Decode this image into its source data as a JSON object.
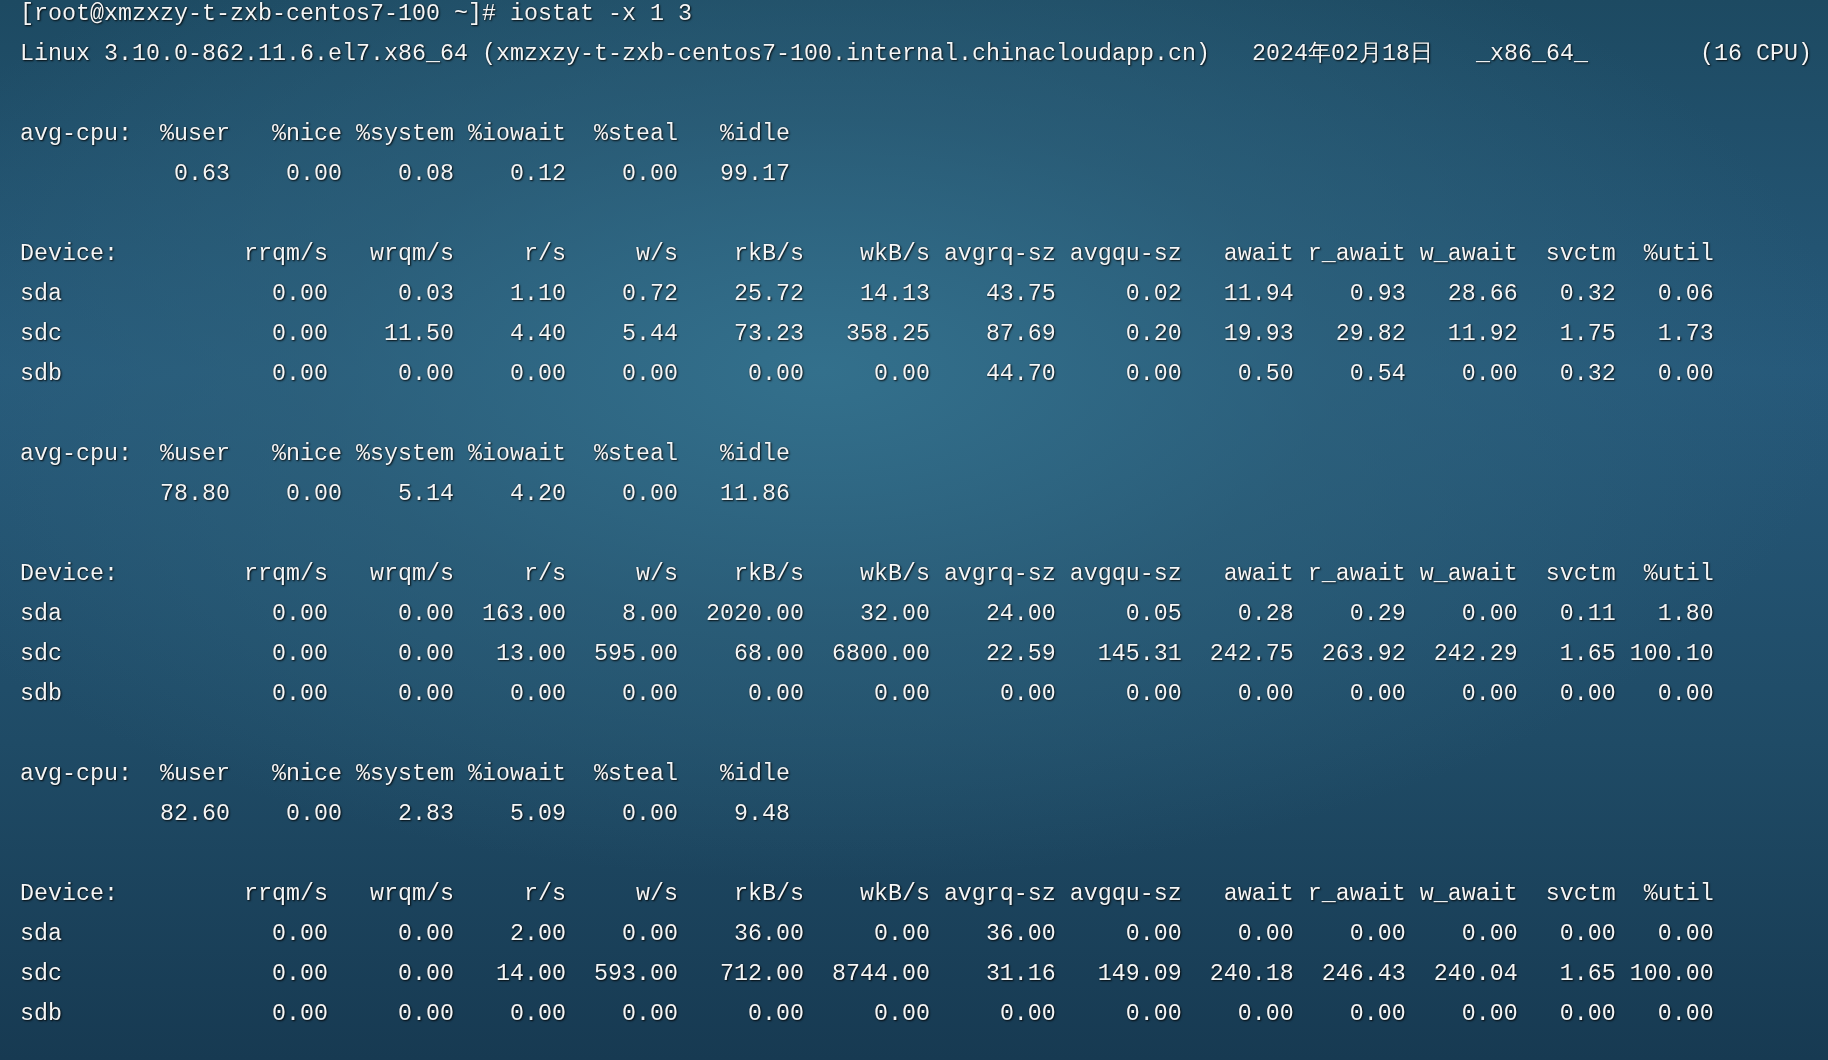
{
  "prompt": {
    "user_host": "[root@xmzxzy-t-zxb-centos7-100 ~]#",
    "command": "iostat -x 1 3"
  },
  "system_info": {
    "kernel": "Linux 3.10.0-862.11.6.el7.x86_64 (xmzxzy-t-zxb-centos7-100.internal.chinacloudapp.cn)",
    "date": "2024年02月18日",
    "arch": "_x86_64_",
    "cpus": "(16 CPU)"
  },
  "reports": [
    {
      "cpu": {
        "label": "avg-cpu:",
        "columns": [
          "%user",
          "%nice",
          "%system",
          "%iowait",
          "%steal",
          "%idle"
        ],
        "values": [
          "0.63",
          "0.00",
          "0.08",
          "0.12",
          "0.00",
          "99.17"
        ]
      },
      "devices": {
        "columns": [
          "Device:",
          "rrqm/s",
          "wrqm/s",
          "r/s",
          "w/s",
          "rkB/s",
          "wkB/s",
          "avgrq-sz",
          "avgqu-sz",
          "await",
          "r_await",
          "w_await",
          "svctm",
          "%util"
        ],
        "rows": [
          {
            "device": "sda",
            "values": [
              "0.00",
              "0.03",
              "1.10",
              "0.72",
              "25.72",
              "14.13",
              "43.75",
              "0.02",
              "11.94",
              "0.93",
              "28.66",
              "0.32",
              "0.06"
            ]
          },
          {
            "device": "sdc",
            "values": [
              "0.00",
              "11.50",
              "4.40",
              "5.44",
              "73.23",
              "358.25",
              "87.69",
              "0.20",
              "19.93",
              "29.82",
              "11.92",
              "1.75",
              "1.73"
            ]
          },
          {
            "device": "sdb",
            "values": [
              "0.00",
              "0.00",
              "0.00",
              "0.00",
              "0.00",
              "0.00",
              "44.70",
              "0.00",
              "0.50",
              "0.54",
              "0.00",
              "0.32",
              "0.00"
            ]
          }
        ]
      }
    },
    {
      "cpu": {
        "label": "avg-cpu:",
        "columns": [
          "%user",
          "%nice",
          "%system",
          "%iowait",
          "%steal",
          "%idle"
        ],
        "values": [
          "78.80",
          "0.00",
          "5.14",
          "4.20",
          "0.00",
          "11.86"
        ]
      },
      "devices": {
        "columns": [
          "Device:",
          "rrqm/s",
          "wrqm/s",
          "r/s",
          "w/s",
          "rkB/s",
          "wkB/s",
          "avgrq-sz",
          "avgqu-sz",
          "await",
          "r_await",
          "w_await",
          "svctm",
          "%util"
        ],
        "rows": [
          {
            "device": "sda",
            "values": [
              "0.00",
              "0.00",
              "163.00",
              "8.00",
              "2020.00",
              "32.00",
              "24.00",
              "0.05",
              "0.28",
              "0.29",
              "0.00",
              "0.11",
              "1.80"
            ]
          },
          {
            "device": "sdc",
            "values": [
              "0.00",
              "0.00",
              "13.00",
              "595.00",
              "68.00",
              "6800.00",
              "22.59",
              "145.31",
              "242.75",
              "263.92",
              "242.29",
              "1.65",
              "100.10"
            ]
          },
          {
            "device": "sdb",
            "values": [
              "0.00",
              "0.00",
              "0.00",
              "0.00",
              "0.00",
              "0.00",
              "0.00",
              "0.00",
              "0.00",
              "0.00",
              "0.00",
              "0.00",
              "0.00"
            ]
          }
        ]
      }
    },
    {
      "cpu": {
        "label": "avg-cpu:",
        "columns": [
          "%user",
          "%nice",
          "%system",
          "%iowait",
          "%steal",
          "%idle"
        ],
        "values": [
          "82.60",
          "0.00",
          "2.83",
          "5.09",
          "0.00",
          "9.48"
        ]
      },
      "devices": {
        "columns": [
          "Device:",
          "rrqm/s",
          "wrqm/s",
          "r/s",
          "w/s",
          "rkB/s",
          "wkB/s",
          "avgrq-sz",
          "avgqu-sz",
          "await",
          "r_await",
          "w_await",
          "svctm",
          "%util"
        ],
        "rows": [
          {
            "device": "sda",
            "values": [
              "0.00",
              "0.00",
              "2.00",
              "0.00",
              "36.00",
              "0.00",
              "36.00",
              "0.00",
              "0.00",
              "0.00",
              "0.00",
              "0.00",
              "0.00"
            ]
          },
          {
            "device": "sdc",
            "values": [
              "0.00",
              "0.00",
              "14.00",
              "593.00",
              "712.00",
              "8744.00",
              "31.16",
              "149.09",
              "240.18",
              "246.43",
              "240.04",
              "1.65",
              "100.00"
            ]
          },
          {
            "device": "sdb",
            "values": [
              "0.00",
              "0.00",
              "0.00",
              "0.00",
              "0.00",
              "0.00",
              "0.00",
              "0.00",
              "0.00",
              "0.00",
              "0.00",
              "0.00",
              "0.00"
            ]
          }
        ]
      }
    }
  ]
}
